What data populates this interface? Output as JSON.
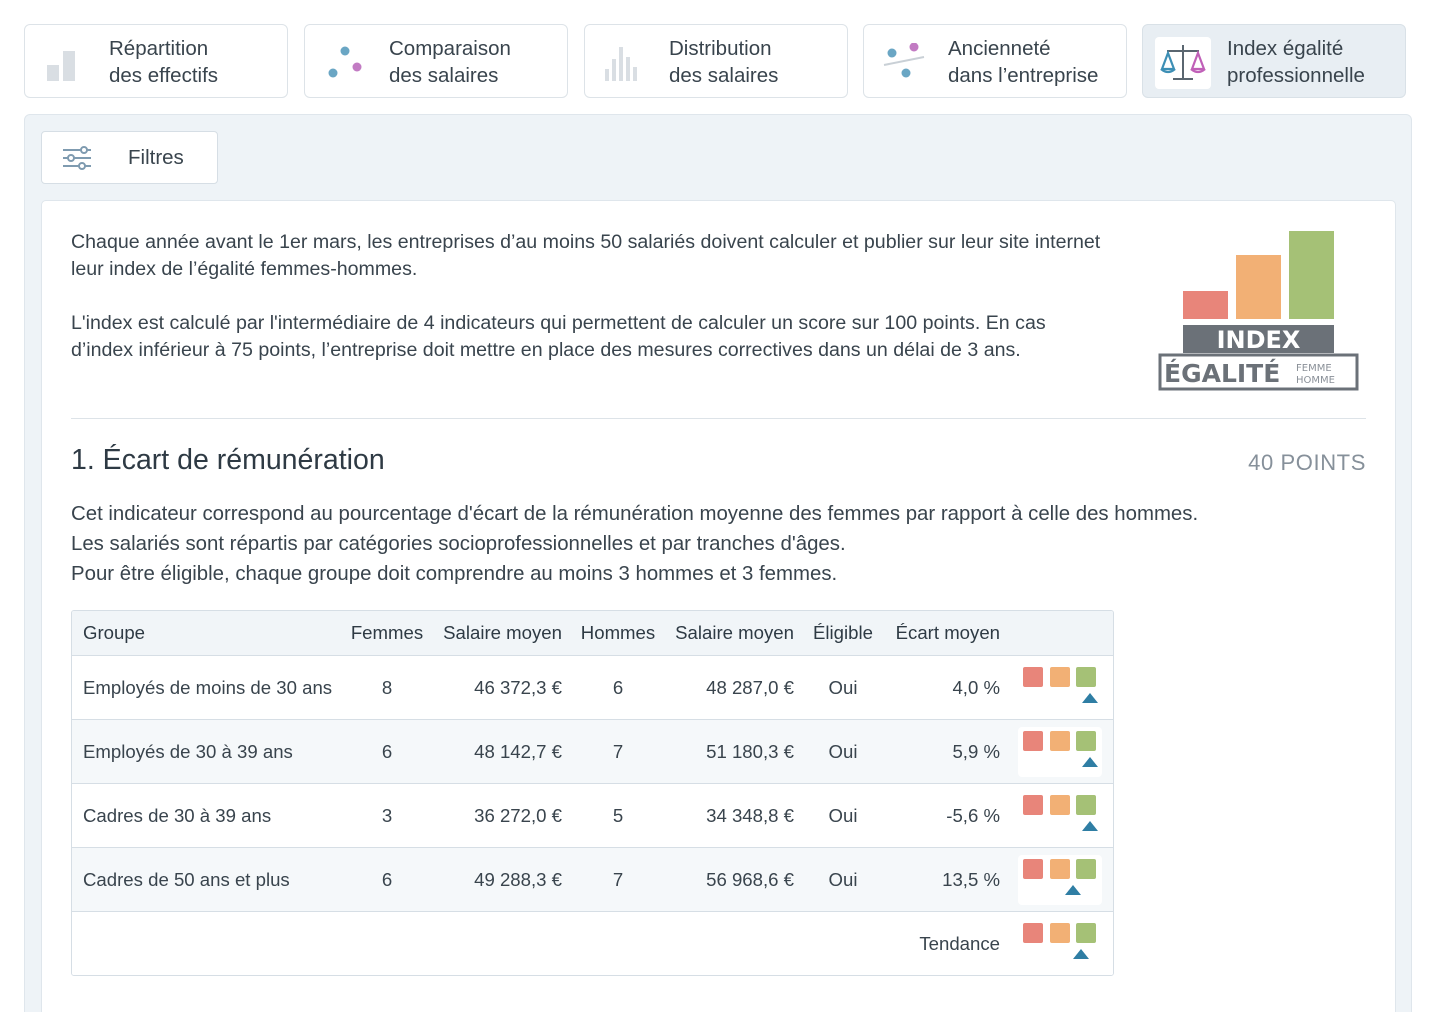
{
  "tabs": [
    {
      "line1": "Répartition",
      "line2": "des effectifs",
      "icon": "bar-chart-icon"
    },
    {
      "line1": "Comparaison",
      "line2": "des salaires",
      "icon": "scatter-dots-icon"
    },
    {
      "line1": "Distribution",
      "line2": "des salaires",
      "icon": "histogram-icon"
    },
    {
      "line1": "Ancienneté",
      "line2": "dans l’entreprise",
      "icon": "trend-dots-icon"
    },
    {
      "line1": "Index égalité",
      "line2": "professionnelle",
      "icon": "balance-scale-icon",
      "active": true
    }
  ],
  "filters": {
    "label": "Filtres",
    "icon": "sliders-icon"
  },
  "intro": {
    "p1": "Chaque année avant le 1er mars, les entreprises d’au moins 50 salariés doivent calculer et publier sur leur site internet leur index de l’égalité femmes-hommes.",
    "p2": "L'index est calculé par l'intermédiaire de 4 indicateurs qui permettent de calculer un score sur 100 points. En cas d’index inférieur à 75 points, l’entreprise doit mettre en place des mesures correctives dans un délai de 3 ans."
  },
  "logo": {
    "word1": "INDEX",
    "word2": "ÉGALITÉ",
    "small1": "FEMME",
    "small2": "HOMME"
  },
  "section": {
    "title": "1. Écart de rémunération",
    "points": "40 POINTS",
    "desc1": "Cet indicateur correspond au pourcentage d'écart de la rémunération moyenne des femmes par rapport à celle des hommes.",
    "desc2": "Les salariés sont répartis par catégories socioprofessionnelles et par tranches d'âges.",
    "desc3": "Pour être éligible, chaque groupe doit comprendre au moins 3 hommes et 3 femmes."
  },
  "table": {
    "headers": {
      "group": "Groupe",
      "women": "Femmes",
      "salary_w": "Salaire moyen",
      "men": "Hommes",
      "salary_m": "Salaire moyen",
      "eligible": "Éligible",
      "gap": "Écart moyen"
    },
    "rows": [
      {
        "group": "Employés de moins de 30 ans",
        "women": "8",
        "salary_w": "46 372,3 €",
        "men": "6",
        "salary_m": "48 287,0 €",
        "eligible": "Oui",
        "gap": "4,0 %",
        "gauge": 0.92
      },
      {
        "group": "Employés de 30 à 39 ans",
        "women": "6",
        "salary_w": "48 142,7 €",
        "men": "7",
        "salary_m": "51 180,3 €",
        "eligible": "Oui",
        "gap": "5,9 %",
        "gauge": 0.92
      },
      {
        "group": "Cadres de 30 à 39 ans",
        "women": "3",
        "salary_w": "36 272,0 €",
        "men": "5",
        "salary_m": "34 348,8 €",
        "eligible": "Oui",
        "gap": "-5,6 %",
        "gauge": 0.92
      },
      {
        "group": "Cadres de 50 ans et plus",
        "women": "6",
        "salary_w": "49 288,3 €",
        "men": "7",
        "salary_m": "56 968,6 €",
        "eligible": "Oui",
        "gap": "13,5 %",
        "gauge": 0.68
      }
    ],
    "trend_label": "Tendance",
    "trend_gauge": 0.8
  },
  "colors": {
    "red": "#e8857a",
    "orange": "#f2b075",
    "green": "#a5c176",
    "marker": "#2f7ea4"
  }
}
